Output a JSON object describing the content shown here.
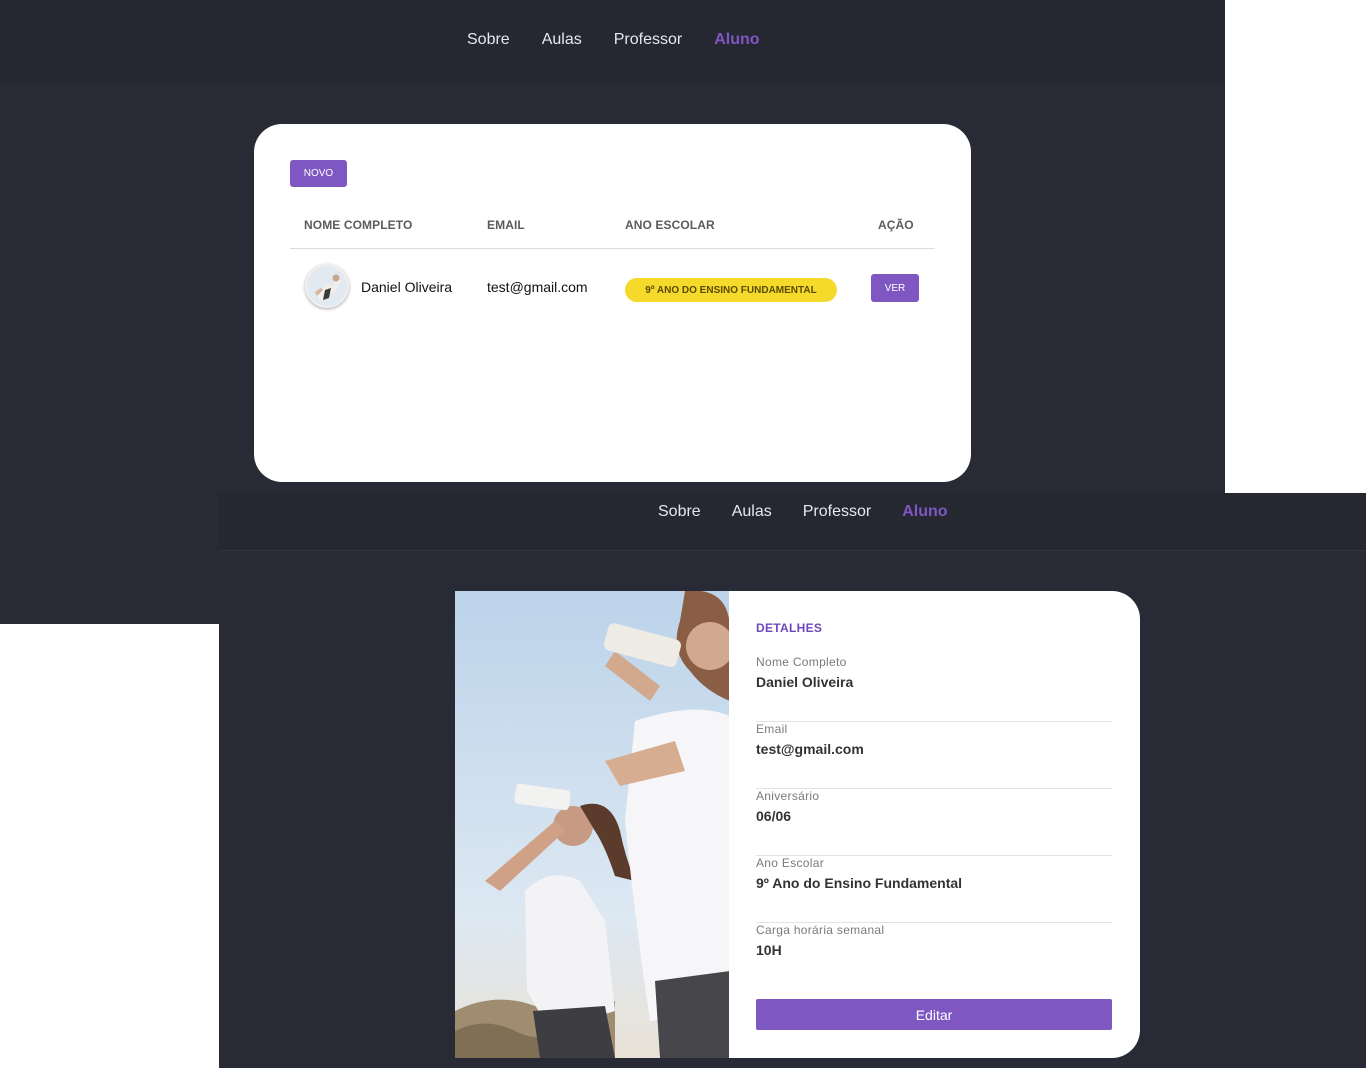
{
  "nav": {
    "items": [
      "Sobre",
      "Aulas",
      "Professor",
      "Aluno"
    ],
    "active": "Aluno",
    "accent_color": "#7e57c2"
  },
  "list": {
    "new_button": "NOVO",
    "headers": {
      "name": "NOME COMPLETO",
      "email": "EMAIL",
      "grade": "ANO ESCOLAR",
      "action": "AÇÃO"
    },
    "rows": [
      {
        "name": "Daniel Oliveira",
        "email": "test@gmail.com",
        "grade": "9º ANO DO ENSINO FUNDAMENTAL",
        "action": "VER",
        "avatar_icon": "student-avatar-photo"
      }
    ]
  },
  "details": {
    "title": "DETALHES",
    "fields": [
      {
        "label": "Nome Completo",
        "value": "Daniel Oliveira"
      },
      {
        "label": "Email",
        "value": "test@gmail.com"
      },
      {
        "label": "Aniversário",
        "value": "06/06"
      },
      {
        "label": "Ano Escolar",
        "value": "9º Ano do Ensino Fundamental"
      },
      {
        "label": "Carga horária semanal",
        "value": "10H"
      }
    ],
    "edit_button": "Editar"
  }
}
